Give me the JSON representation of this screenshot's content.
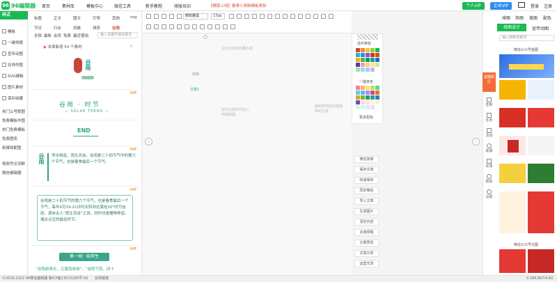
{
  "top": {
    "logo": "96编辑器",
    "nav": [
      "首页",
      "素材库",
      "模板中心",
      "微信工具",
      "新手教程",
      "排版培训"
    ],
    "notice": "【模版上线】春季小清新模板更新",
    "vip_btn": "个人VIP",
    "enterprise_btn": "企业VIP",
    "login": "登录",
    "register": "注册"
  },
  "left": {
    "header": "样式",
    "items": [
      "模板",
      "一键排版",
      "宣传动图",
      "在线作图",
      "SVG编辑",
      "图片素材",
      "保存收藏",
      "热门公号配图",
      "免费模板作图",
      "热门免费模板",
      "免费图库",
      "新媒体配图",
      "视频号交流群",
      "微信编辑器"
    ]
  },
  "panel": {
    "tabs_row1": [
      "标题",
      "正文",
      "图文",
      "引导",
      "其他",
      "svg"
    ],
    "tabs_row2": [
      "节日",
      "行业",
      "风格",
      "排序",
      "谷雨"
    ],
    "filters": [
      "全部",
      "最新",
      "会员",
      "免费",
      "最近使用"
    ],
    "search_placeholder": "输入关键字或关键词",
    "banner": "本周新增 54 个素材",
    "vip_tag": "VIP",
    "card1_title": "谷雨",
    "card2_main": "谷雨 · 时节",
    "card2_sub": "— SOLAR TERMS —",
    "card3": "END",
    "card4_title": "谷雨",
    "card4_text": "萍水相逢，雨生百谷。谷雨是二十四节气中的第六个节气，也是春季最后一个节气。",
    "card5_text": "谷雨是二十四节气的第六个节气，也是春季最后一个节气，每年4月19-21日时太阳到达黄经30°时为谷雨，源自古人“雨生百谷”之说。同时也是播种移苗、埯瓜点豆的最佳时节。",
    "card6_title": "第一帧：始萍生",
    "card6_text": "“谷雨前两天，立夏雨淋淋”，“谷雨下雨，四十"
  },
  "editor": {
    "font_select": "微软雅黑",
    "size_select": "17px",
    "hint_top": "在此处添加收藏内容",
    "hint_title": "标题",
    "hint_text": "文章1",
    "hint_left": "鼠标左键样式插入到编辑器",
    "hint_right": "编辑框架鼠标拖拽到的位置"
  },
  "colors": {
    "label1": "选中换色",
    "label2": "一键变色",
    "label3": "更多配色",
    "grid": [
      "#e23b3b",
      "#f18a2b",
      "#f6c13a",
      "#9acd32",
      "#19b955",
      "#23b7c5",
      "#2d8cf0",
      "#7b5cd6",
      "#c0392b",
      "#d35400",
      "#e6b800",
      "#6aa84f",
      "#0f9d58",
      "#16a085",
      "#1e6fc6",
      "#5e35b1",
      "#f2a1a1",
      "#f8c99a",
      "#fbe39a",
      "#cfe8a0",
      "#9fe0b9",
      "#9fdde5",
      "#a8cdf7",
      "#c9b7ef"
    ],
    "grid2": [
      "#ff7b9c",
      "#ffb36b",
      "#ffe26b",
      "#b7e26b",
      "#62d39b",
      "#62cfd9",
      "#6bb0ff",
      "#a98bff",
      "#d24d72",
      "#d67a2d",
      "#d1ae2a",
      "#7bb23c",
      "#2c9b6b",
      "#2b9aa3",
      "#3a7ac2",
      "#6b4fbf",
      "#ffd6e0",
      "#ffe6cc",
      "#fff5cc",
      "#e9f7d1",
      "#d6f5e6",
      "#d3f2f5",
      "#dbeaff",
      "#e8e0ff"
    ]
  },
  "actions": [
    "微信复制",
    "保存文章",
    "快速保存",
    "同步微信",
    "导入文章",
    "生成图片",
    "清空内容",
    "云端草稿",
    "文章预览",
    "文章分享",
    "运营交流"
  ],
  "right": {
    "tabs": [
      "排图",
      "热图",
      "美图",
      "配色"
    ],
    "active_tab": "找图设计",
    "second_tab": "宣传动图",
    "search_placeholder": "输入搜索关键词",
    "section1": "微信公众号首图",
    "section2": "微信公众号次图",
    "side": [
      "首图配行",
      "签到",
      "任务",
      "活动",
      "客服",
      "反馈",
      "帮助",
      "设置"
    ]
  },
  "footer": {
    "copyright": "©2016-2022 96微信编辑器 鲁ICP备13013285号-92",
    "links": "友情链接",
    "right": "0.289.897/4.60"
  }
}
